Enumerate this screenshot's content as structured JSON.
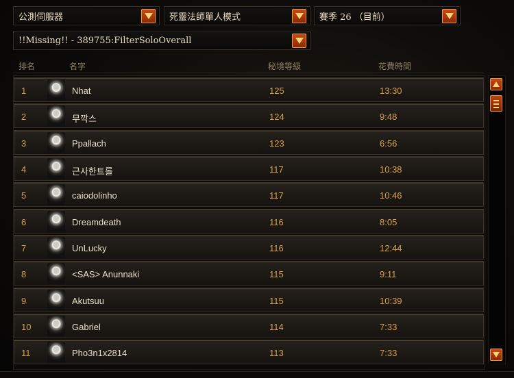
{
  "filters": {
    "server": "公測伺服器",
    "mode": "死靈法師單人模式",
    "season": "賽季 26 （目前）",
    "filter": "!!Missing!! - 389755:FilterSoloOverall"
  },
  "columns": {
    "rank": "排名",
    "name": "名字",
    "level": "秘境等級",
    "time": "花費時間"
  },
  "rows": [
    {
      "rank": "1",
      "name": "Nhat",
      "level": "125",
      "time": "13:30"
    },
    {
      "rank": "2",
      "name": "무깍스",
      "level": "124",
      "time": "9:48"
    },
    {
      "rank": "3",
      "name": "Ppallach",
      "level": "123",
      "time": "6:56"
    },
    {
      "rank": "4",
      "name": "근사한트롤",
      "level": "117",
      "time": "10:38"
    },
    {
      "rank": "5",
      "name": "caiodolinho",
      "level": "117",
      "time": "10:46"
    },
    {
      "rank": "6",
      "name": "Dreamdeath",
      "level": "116",
      "time": "8:05"
    },
    {
      "rank": "7",
      "name": "UnLucky",
      "level": "116",
      "time": "12:44"
    },
    {
      "rank": "8",
      "name": "<SAS> Anunnaki",
      "level": "115",
      "time": "9:11"
    },
    {
      "rank": "9",
      "name": "Akutsuu",
      "level": "115",
      "time": "10:39"
    },
    {
      "rank": "10",
      "name": "Gabriel",
      "level": "114",
      "time": "7:33"
    },
    {
      "rank": "11",
      "name": "Pho3n1x2814",
      "level": "113",
      "time": "7:33"
    }
  ]
}
